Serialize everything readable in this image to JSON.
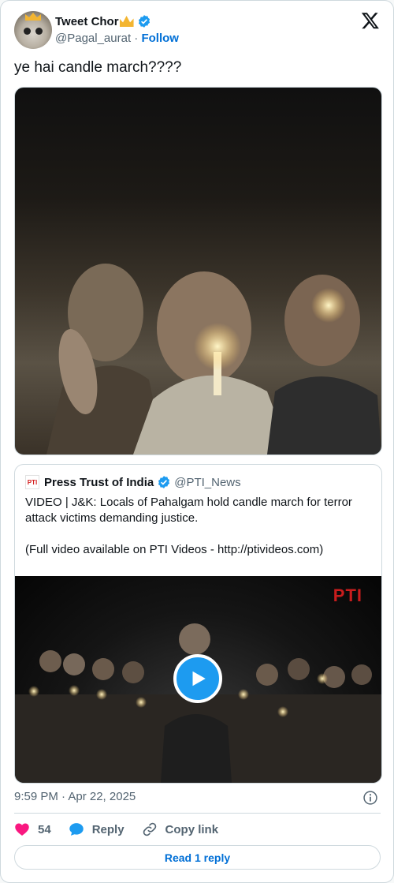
{
  "author": {
    "name": "Tweet Chor",
    "handle": "@Pagal_aurat",
    "separator": "·",
    "follow_label": "Follow"
  },
  "tweet": {
    "text": "ye hai candle march????"
  },
  "quoted": {
    "name": "Press Trust of India",
    "handle": "@PTI_News",
    "logo_text": "PTI",
    "text": "VIDEO | J&K: Locals of Pahalgam hold candle march for terror attack victims demanding justice.\n\n(Full video available on PTI Videos - http://ptivideos.com)",
    "watermark": "PTI"
  },
  "meta": {
    "timestamp": "9:59 PM · Apr 22, 2025"
  },
  "actions": {
    "like_count": "54",
    "reply_label": "Reply",
    "copy_label": "Copy link",
    "read_reply_label": "Read 1 reply"
  },
  "colors": {
    "accent": "#1d9bf0",
    "link": "#006fd6",
    "like": "#f91880",
    "muted": "#536471",
    "border": "#cfd9de"
  },
  "icons": [
    "avatar",
    "verified-icon",
    "x-logo-icon",
    "play-icon",
    "info-icon",
    "heart-icon",
    "reply-icon",
    "link-icon"
  ]
}
